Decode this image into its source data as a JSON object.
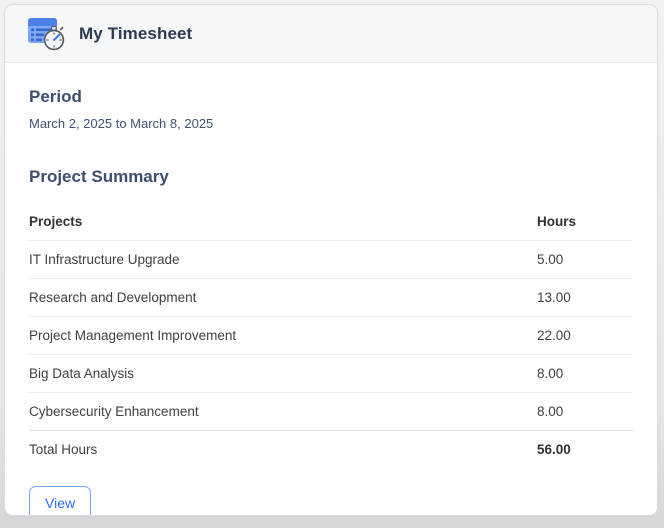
{
  "card": {
    "title": "My Timesheet",
    "icon": "timesheet-stopwatch-icon"
  },
  "period": {
    "heading": "Period",
    "range": "March 2, 2025 to March 8, 2025"
  },
  "summary": {
    "heading": "Project Summary",
    "table": {
      "columns": [
        "Projects",
        "Hours"
      ],
      "rows": [
        {
          "project": "IT Infrastructure Upgrade",
          "hours": "5.00"
        },
        {
          "project": "Research and Development",
          "hours": "13.00"
        },
        {
          "project": "Project Management Improvement",
          "hours": "22.00"
        },
        {
          "project": "Big Data Analysis",
          "hours": "8.00"
        },
        {
          "project": "Cybersecurity Enhancement",
          "hours": "8.00"
        }
      ],
      "total_label": "Total Hours",
      "total_hours": "56.00"
    }
  },
  "actions": {
    "view_label": "View"
  },
  "colors": {
    "accent_blue": "#2470f3",
    "title_navy": "#2d3b55",
    "heading_navy": "#3d4e6e",
    "header_bar_bg": "#f6f7f8",
    "icon_blue_light": "#7ea9f2",
    "icon_blue_dark": "#4c80e9"
  }
}
